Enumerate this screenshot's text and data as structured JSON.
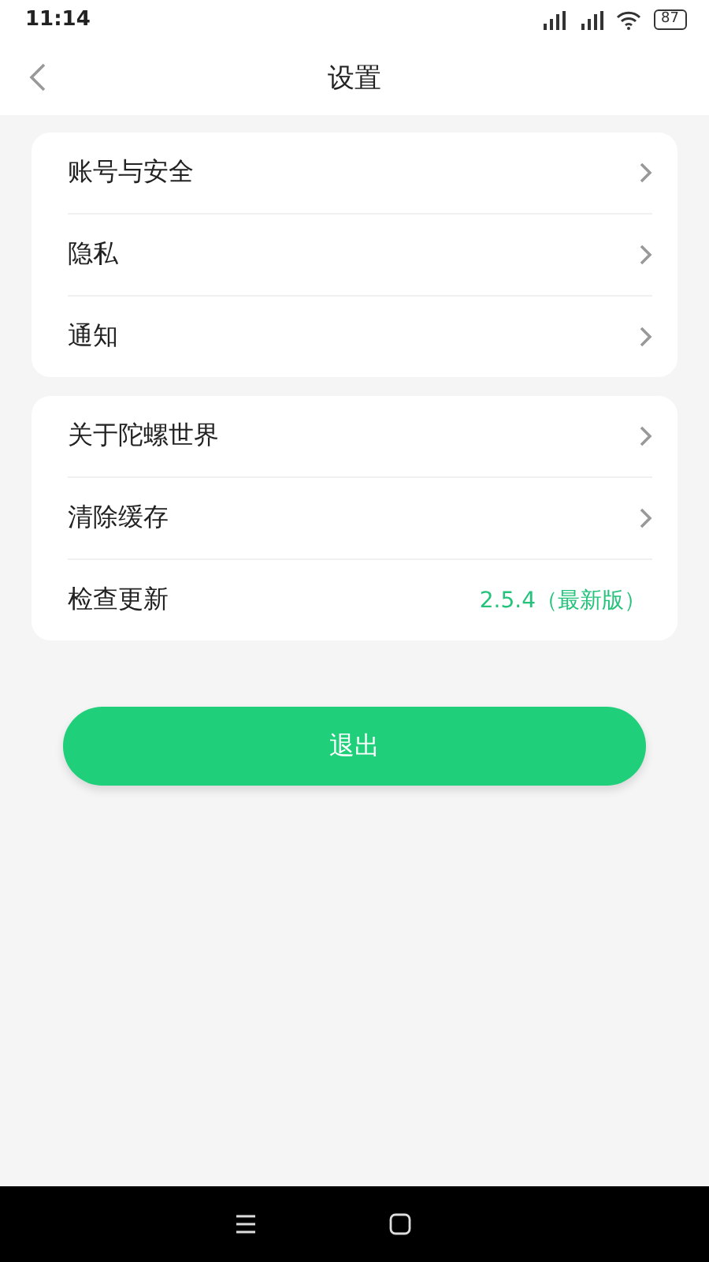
{
  "status_bar": {
    "time": "11:14",
    "battery": "87"
  },
  "header": {
    "title": "设置"
  },
  "groups": [
    {
      "rows": [
        {
          "kind": "link",
          "label": "账号与安全"
        },
        {
          "kind": "link",
          "label": "隐私"
        },
        {
          "kind": "link",
          "label": "通知"
        }
      ]
    },
    {
      "rows": [
        {
          "kind": "link",
          "label": "关于陀螺世界"
        },
        {
          "kind": "link",
          "label": "清除缓存"
        },
        {
          "kind": "value",
          "label": "检查更新",
          "value": "2.5.4（最新版）"
        }
      ]
    }
  ],
  "logout_button": {
    "label": "退出"
  }
}
